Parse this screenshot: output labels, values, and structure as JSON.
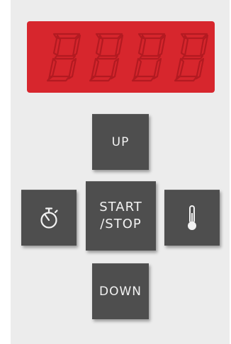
{
  "display": {
    "digits": [
      "8",
      "8",
      "8",
      "8"
    ],
    "color": "#d7262d"
  },
  "buttons": {
    "up_label": "UP",
    "start_stop_label_line1": "START",
    "start_stop_label_line2": "/STOP",
    "down_label": "DOWN",
    "timer_icon": "stopwatch-icon",
    "temp_icon": "thermometer-icon"
  },
  "colors": {
    "panel_bg": "#ececec",
    "button_bg": "#4e4e4e",
    "button_text": "#f2f2f2"
  }
}
